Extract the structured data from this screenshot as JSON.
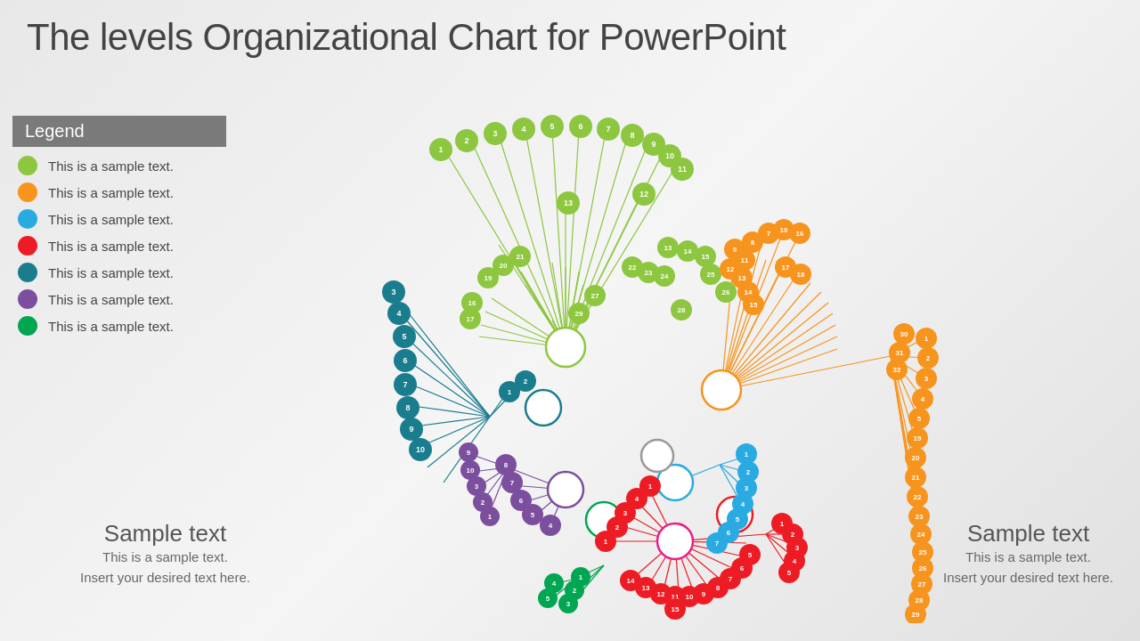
{
  "title": "The levels Organizational Chart for PowerPoint",
  "legend": {
    "header": "Legend",
    "items": [
      {
        "color": "#8dc63f",
        "text": "This is a sample text."
      },
      {
        "color": "#f7941d",
        "text": "This is a sample text."
      },
      {
        "color": "#29abe2",
        "text": "This is a sample text."
      },
      {
        "color": "#ed1c24",
        "text": "This is a sample text."
      },
      {
        "color": "#1a7d8e",
        "text": "This is a sample text."
      },
      {
        "color": "#7b4f9e",
        "text": "This is a sample text."
      },
      {
        "color": "#00a651",
        "text": "This is a sample text."
      }
    ]
  },
  "sample_text_left": {
    "heading": "Sample text",
    "line1": "This is a sample text.",
    "line2": "Insert your desired text here."
  },
  "sample_text_right": {
    "heading": "Sample text",
    "line1": "This is a sample text.",
    "line2": "Insert your desired text here."
  },
  "colors": {
    "green": "#8dc63f",
    "orange": "#f7941d",
    "cyan": "#29abe2",
    "red": "#ed1c24",
    "teal": "#1a7d8e",
    "purple": "#7b4f9e",
    "darkgreen": "#00a651",
    "gray": "#999",
    "pink": "#e91e8c"
  }
}
